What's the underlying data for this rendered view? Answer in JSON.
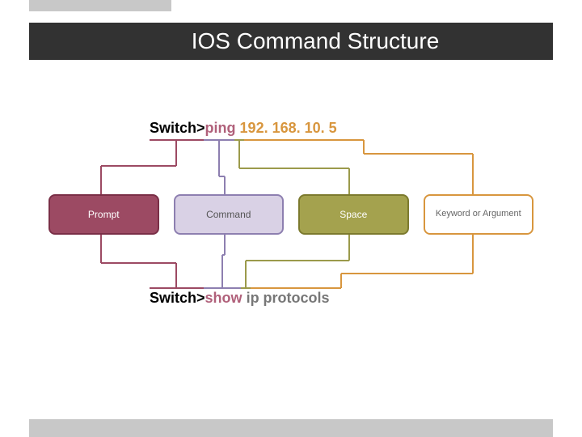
{
  "title": "IOS Command Structure",
  "top_example": {
    "prompt": "Switch>",
    "command": "ping",
    "space": " ",
    "argument": "192. 168. 10. 5"
  },
  "bottom_example": {
    "prompt": "Switch>",
    "command": "show",
    "space": " ",
    "keyword": "ip protocols"
  },
  "categories": {
    "prompt": "Prompt",
    "command": "Command",
    "space": "Space",
    "keyword": "Keyword or Argument"
  },
  "colors": {
    "prompt": "#9c4a63",
    "command": "#8d7fb0",
    "space": "#a4a24e",
    "keyword": "#d8963e",
    "title_bg": "#323232",
    "bar_grey": "#c8c8c8"
  }
}
